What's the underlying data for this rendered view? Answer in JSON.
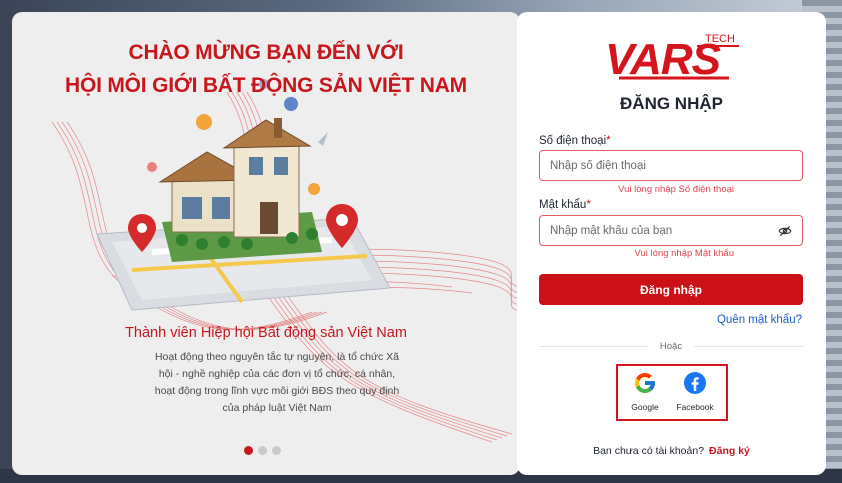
{
  "hero": {
    "title_line1": "CHÀO MỪNG BẠN ĐẾN VỚI",
    "title_line2": "HỘI MÔI GIỚI BẤT ĐỘNG SẢN VIỆT NAM",
    "subtitle": "Thành viên Hiệp hội Bất động sản Việt Nam",
    "description_lines": [
      "Hoạt động theo nguyên tắc tự nguyện, là tổ chức Xã",
      "hội - nghề nghiệp của các đơn vị tổ chức, cá nhân,",
      "hoạt động trong lĩnh vực môi giới BĐS theo quy định",
      "của pháp luật Việt Nam"
    ],
    "carousel": {
      "total": 3,
      "active": 1
    }
  },
  "brand": {
    "logo_text": "VARS",
    "logo_sub": "TECH",
    "accent": "#c8161d"
  },
  "login": {
    "title": "ĐĂNG NHẬP",
    "phone": {
      "label": "Số điện thoại",
      "required_mark": "*",
      "placeholder": "Nhập số điện thoại",
      "value": "",
      "error": "Vui lòng nhập Số điện thoại"
    },
    "password": {
      "label": "Mật khẩu",
      "required_mark": "*",
      "placeholder": "Nhập mật khẩu của bạn",
      "value": "",
      "error": "Vui lòng nhập Mật khẩu"
    },
    "submit_label": "Đăng nhập",
    "forgot_label": "Quên mật khẩu?",
    "or_label": "Hoặc",
    "social": [
      {
        "name": "Google",
        "icon": "google-icon"
      },
      {
        "name": "Facebook",
        "icon": "facebook-icon"
      }
    ],
    "signup_prompt": "Bạn chưa có tài khoản?",
    "signup_link": "Đăng ký"
  }
}
